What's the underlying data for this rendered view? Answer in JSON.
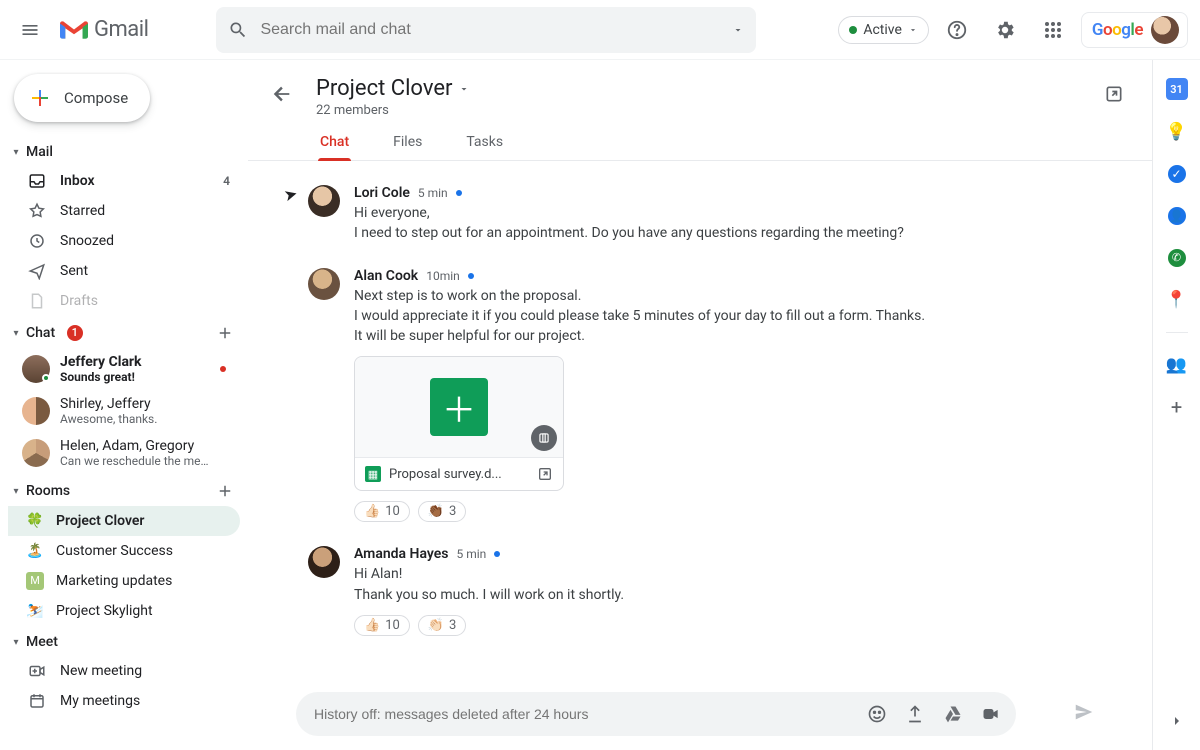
{
  "app": {
    "name": "Gmail"
  },
  "search": {
    "placeholder": "Search mail and chat"
  },
  "status": {
    "label": "Active"
  },
  "google_word": [
    "G",
    "o",
    "o",
    "g",
    "l",
    "e"
  ],
  "compose_label": "Compose",
  "sections": {
    "mail": "Mail",
    "chat": "Chat",
    "rooms": "Rooms",
    "meet": "Meet"
  },
  "chat_badge": "1",
  "mail_folders": [
    {
      "label": "Inbox",
      "count": "4",
      "bold": true
    },
    {
      "label": "Starred"
    },
    {
      "label": "Snoozed"
    },
    {
      "label": "Sent"
    },
    {
      "label": "Drafts"
    }
  ],
  "chats": [
    {
      "name": "Jeffery Clark",
      "preview": "Sounds great!",
      "bold": true,
      "presence": true,
      "unread": true
    },
    {
      "name": "Shirley, Jeffery",
      "preview": "Awesome, thanks."
    },
    {
      "name": "Helen, Adam, Gregory",
      "preview": "Can we reschedule the meeti..."
    }
  ],
  "rooms": [
    {
      "label": "Project Clover",
      "emoji": "🍀",
      "selected": true
    },
    {
      "label": "Customer Success",
      "emoji": "🏝️"
    },
    {
      "label": "Marketing updates",
      "emoji": "M",
      "letter": true
    },
    {
      "label": "Project Skylight",
      "emoji": "⛷️"
    }
  ],
  "meet_items": [
    {
      "label": "New meeting"
    },
    {
      "label": "My meetings"
    }
  ],
  "room": {
    "title": "Project Clover",
    "subtitle": "22 members",
    "tabs": [
      "Chat",
      "Files",
      "Tasks"
    ]
  },
  "messages": [
    {
      "sender": "Lori Cole",
      "time": "5 min",
      "lines": [
        "Hi everyone,",
        "I need to step out for an appointment. Do you have any questions regarding the meeting?"
      ]
    },
    {
      "sender": "Alan Cook",
      "time": "10min",
      "lines": [
        "Next step is to work on the proposal.",
        "I would appreciate it if you could please take 5 minutes of your day to fill out a form. Thanks.",
        "It will be super helpful for our project."
      ],
      "attachment": {
        "filename": "Proposal survey.d..."
      },
      "reactions": [
        {
          "emoji": "👍🏻",
          "count": "10"
        },
        {
          "emoji": "👏🏾",
          "count": "3"
        }
      ]
    },
    {
      "sender": "Amanda Hayes",
      "time": "5 min",
      "lines": [
        "Hi Alan!",
        "Thank you so much. I will work on it shortly."
      ],
      "reactions": [
        {
          "emoji": "👍🏻",
          "count": "10"
        },
        {
          "emoji": "👏🏻",
          "count": "3"
        }
      ]
    }
  ],
  "composer": {
    "placeholder": "History off: messages deleted after 24 hours"
  },
  "side_panel_date": "31"
}
